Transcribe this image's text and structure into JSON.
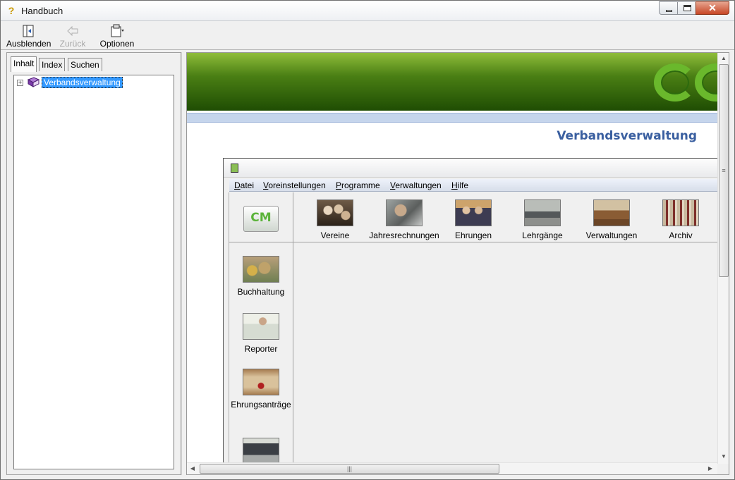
{
  "window": {
    "title": "Handbuch"
  },
  "toolbar": {
    "hide_label": "Ausblenden",
    "back_label": "Zurück",
    "options_label": "Optionen"
  },
  "nav": {
    "tabs": [
      {
        "label": "Inhalt",
        "active": true
      },
      {
        "label": "Index",
        "active": false
      },
      {
        "label": "Suchen",
        "active": false
      }
    ],
    "tree": [
      {
        "label": "Verbandsverwaltung",
        "expander": "+",
        "selected": true
      }
    ]
  },
  "content": {
    "heading": "Verbandsverwaltung",
    "app": {
      "menu": [
        "Datei",
        "Voreinstellungen",
        "Programme",
        "Verwaltungen",
        "Hilfe"
      ],
      "logo_text": "CM",
      "top_buttons": [
        "Vereine",
        "Jahresrechnungen",
        "Ehrungen",
        "Lehrgänge",
        "Verwaltungen",
        "Archiv"
      ],
      "side_buttons": [
        "Buchhaltung",
        "Reporter",
        "Ehrungsanträge"
      ]
    }
  },
  "colors": {
    "heading": "#3a5fa0",
    "banner_dark": "#1f4d03",
    "banner_light": "#8fbd3a",
    "selection": "#3399ff"
  }
}
